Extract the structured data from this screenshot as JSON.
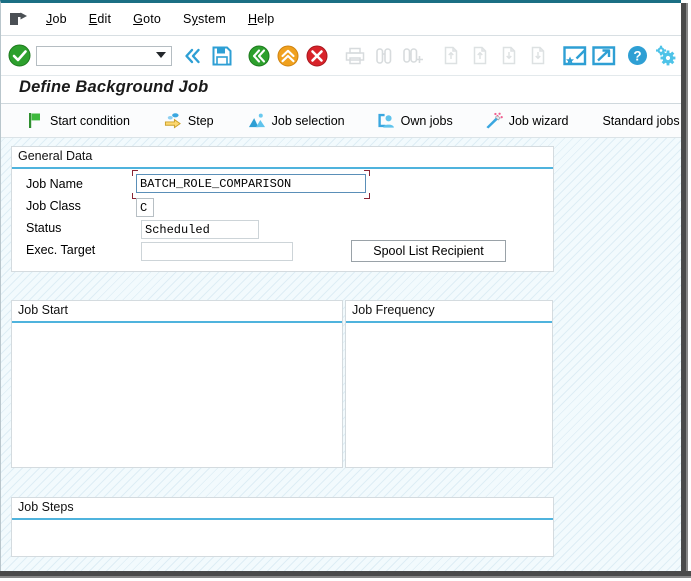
{
  "window": {
    "app": "SAP GUI",
    "title": "Define Background Job"
  },
  "menubar": {
    "system_icon": "menu-window-icon",
    "items": [
      {
        "label": "Job",
        "accel": "J"
      },
      {
        "label": "Edit",
        "accel": "E"
      },
      {
        "label": "Goto",
        "accel": "G"
      },
      {
        "label": "System",
        "accel": "y"
      },
      {
        "label": "Help",
        "accel": "H"
      }
    ]
  },
  "toolbar": {
    "enter_tooltip": "Enter",
    "command_field": {
      "value": "",
      "placeholder": ""
    },
    "buttons": [
      {
        "name": "enter-button",
        "icon": "green-check-circle-icon",
        "enabled": true
      },
      {
        "name": "command-history-button",
        "icon": "double-chevron-left-icon",
        "enabled": true
      },
      {
        "name": "save-button",
        "icon": "save-floppy-icon",
        "enabled": true
      },
      {
        "name": "back-button",
        "icon": "back-green-circle-icon",
        "enabled": true
      },
      {
        "name": "exit-button",
        "icon": "exit-up-orange-circle-icon",
        "enabled": true
      },
      {
        "name": "cancel-button",
        "icon": "cancel-red-circle-icon",
        "enabled": true
      },
      {
        "name": "print-button",
        "icon": "printer-icon",
        "enabled": false
      },
      {
        "name": "find-button",
        "icon": "binoculars-icon",
        "enabled": false
      },
      {
        "name": "find-next-button",
        "icon": "binoculars-plus-icon",
        "enabled": false
      },
      {
        "name": "first-page-button",
        "icon": "first-page-icon",
        "enabled": false
      },
      {
        "name": "previous-page-button",
        "icon": "previous-page-icon",
        "enabled": false
      },
      {
        "name": "next-page-button",
        "icon": "next-page-icon",
        "enabled": false
      },
      {
        "name": "last-page-button",
        "icon": "last-page-icon",
        "enabled": false
      },
      {
        "name": "create-session-button",
        "icon": "new-session-star-icon",
        "enabled": true
      },
      {
        "name": "create-shortcut-button",
        "icon": "shortcut-arrow-icon",
        "enabled": true
      },
      {
        "name": "help-button",
        "icon": "help-question-circle-icon",
        "enabled": true
      },
      {
        "name": "customize-button",
        "icon": "gear-customize-icon",
        "enabled": true
      }
    ]
  },
  "app_toolbar": {
    "buttons": [
      {
        "label": "Start condition",
        "icon": "green-flag-icon",
        "name": "start-condition-button"
      },
      {
        "label": "Step",
        "icon": "yellow-arrow-step-icon",
        "name": "step-button"
      },
      {
        "label": "Job selection",
        "icon": "blue-mountains-icon",
        "name": "job-selection-button"
      },
      {
        "label": "Own jobs",
        "icon": "person-card-icon",
        "name": "own-jobs-button"
      },
      {
        "label": "Job wizard",
        "icon": "magic-wand-icon",
        "name": "job-wizard-button"
      },
      {
        "label": "Standard jobs",
        "icon": "",
        "name": "standard-jobs-button"
      }
    ]
  },
  "general_data": {
    "title": "General Data",
    "fields": [
      {
        "label": "Job Name",
        "value": "BATCH_ROLE_COMPARISON",
        "readonly": false,
        "focused": true,
        "name": "job-name"
      },
      {
        "label": "Job Class",
        "value": "C",
        "readonly": false,
        "focused": false,
        "name": "job-class"
      },
      {
        "label": "Status",
        "value": "Scheduled",
        "readonly": true,
        "focused": false,
        "name": "status"
      },
      {
        "label": "Exec. Target",
        "value": "",
        "readonly": false,
        "focused": false,
        "name": "exec-target"
      }
    ],
    "spool_button": "Spool List Recipient"
  },
  "job_start": {
    "title": "Job Start",
    "content": ""
  },
  "job_frequency": {
    "title": "Job Frequency",
    "content": ""
  },
  "job_steps": {
    "title": "Job Steps",
    "content": ""
  },
  "colors": {
    "accent_blue": "#4fb3dd",
    "frame_teal": "#1b6f84",
    "canvas_bg": "#f2fafd",
    "focus_bracket": "#8a2535",
    "ok_green": "#34a23a",
    "warn_orange": "#f0a11e",
    "error_red": "#d8232a"
  }
}
